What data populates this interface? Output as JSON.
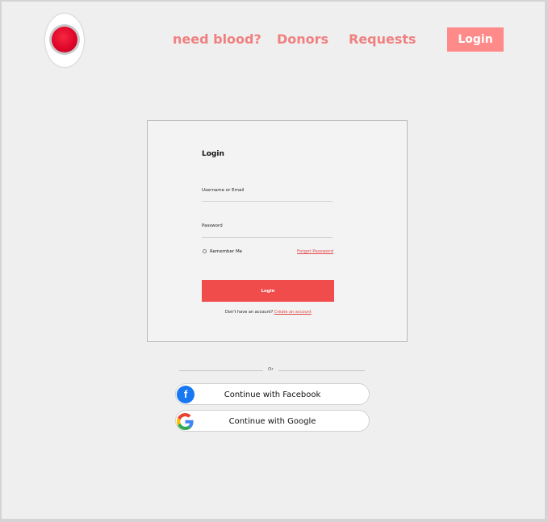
{
  "nav": {
    "links": [
      "need blood?",
      "Donors",
      "Requests"
    ],
    "login_label": "Login"
  },
  "login_card": {
    "title": "Login",
    "username_label": "Username or Email",
    "password_label": "Password",
    "remember_label": "Remember Me",
    "forgot_label": "Forgot Password",
    "submit_label": "Login",
    "no_account_text": "Don't have an account?",
    "create_account_label": "Create an account"
  },
  "divider": {
    "text": "Or"
  },
  "social": {
    "facebook_label": "Continue with Facebook",
    "google_label": "Continue with Google"
  },
  "colors": {
    "accent": "#f14c4c",
    "nav_text": "#f08080",
    "nav_button": "#ff8a8a",
    "facebook": "#1877f2"
  }
}
